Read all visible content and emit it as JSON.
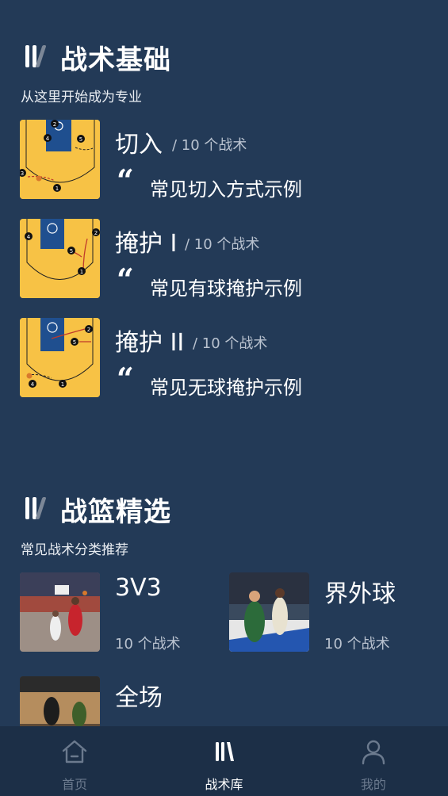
{
  "basics": {
    "title": "战术基础",
    "subtitle": "从这里开始成为专业",
    "items": [
      {
        "name": "切入",
        "count": "/ 10 个战术",
        "desc": "常见切入方式示例"
      },
      {
        "name": "掩护 I",
        "count": "/ 10 个战术",
        "desc": "常见有球掩护示例"
      },
      {
        "name": "掩护 II",
        "count": "/ 10 个战术",
        "desc": "常见无球掩护示例"
      }
    ]
  },
  "picks": {
    "title": "战篮精选",
    "subtitle": "常见战术分类推荐",
    "items": [
      {
        "name": "3V3",
        "count": "10 个战术"
      },
      {
        "name": "界外球",
        "count": "10 个战术"
      },
      {
        "name": "全场",
        "count": ""
      }
    ]
  },
  "quote_glyph": "“",
  "tabbar": {
    "tabs": [
      {
        "label": "首页",
        "icon": "home-icon",
        "active": false
      },
      {
        "label": "战术库",
        "icon": "tactics-logo-icon",
        "active": true
      },
      {
        "label": "我的",
        "icon": "user-icon",
        "active": false
      }
    ]
  },
  "colors": {
    "background": "#233a57",
    "court": "#f7c245",
    "paint": "#1f4f8f",
    "tabbar": "#1c2f47"
  }
}
